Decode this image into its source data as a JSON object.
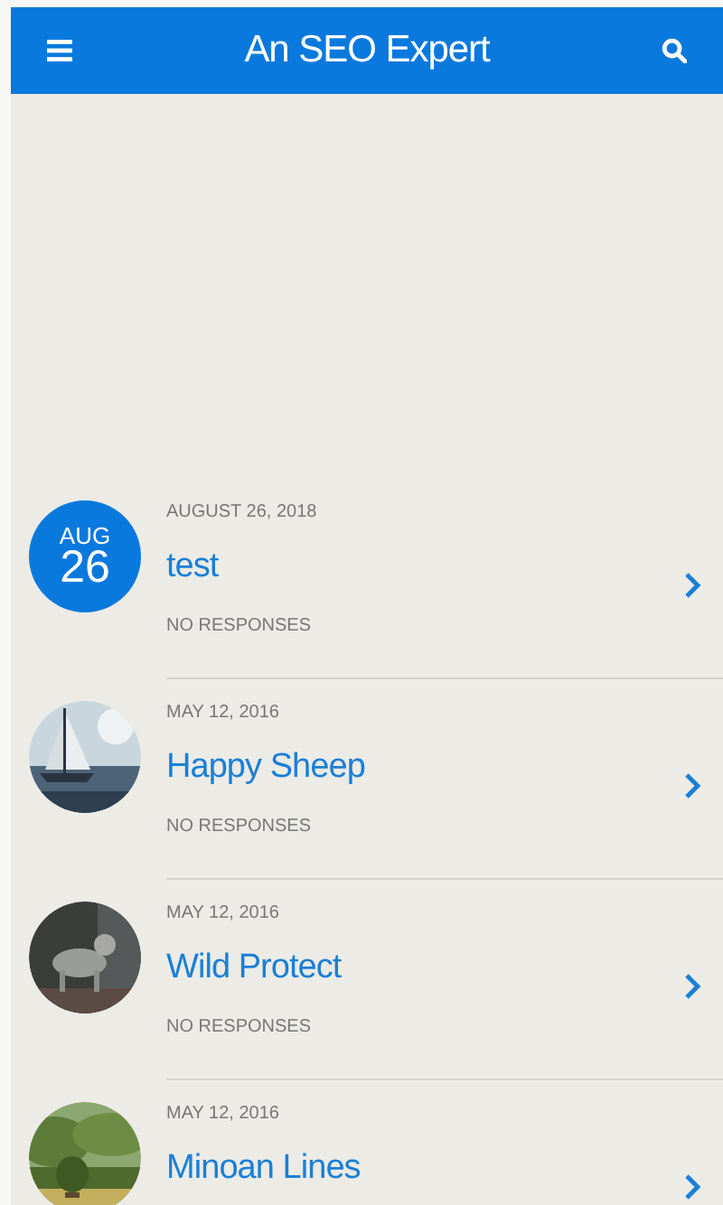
{
  "header": {
    "title": "An SEO Expert"
  },
  "posts": [
    {
      "kind": "date",
      "month": "AUG",
      "day": "26",
      "date": "AUGUST 26, 2018",
      "title": "test",
      "responses": "NO RESPONSES"
    },
    {
      "kind": "picture",
      "date": "MAY 12, 2016",
      "title": "Happy Sheep",
      "responses": "NO RESPONSES"
    },
    {
      "kind": "picture",
      "date": "MAY 12, 2016",
      "title": "Wild Protect",
      "responses": "NO RESPONSES"
    },
    {
      "kind": "picture",
      "date": "MAY 12, 2016",
      "title": "Minoan Lines"
    }
  ]
}
